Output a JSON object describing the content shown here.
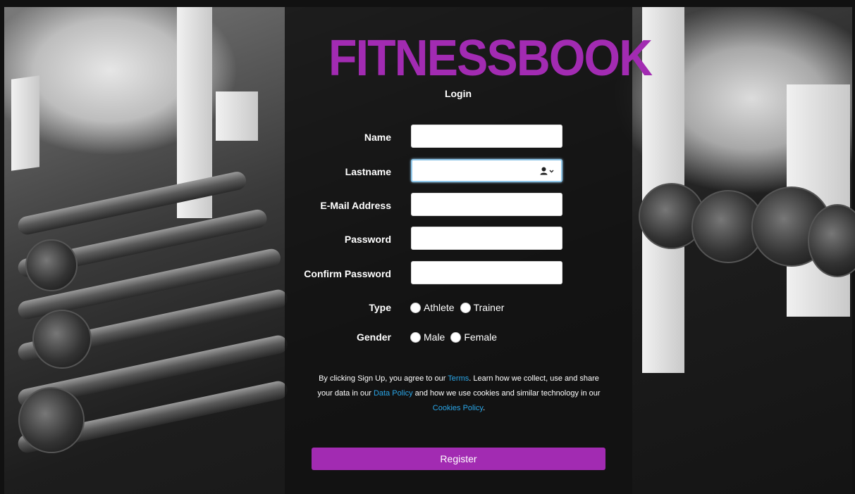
{
  "brand": {
    "name": "FITNESSBOOK",
    "color": "#a22bb2"
  },
  "page": {
    "subtitle": "Login"
  },
  "form": {
    "name_label": "Name",
    "lastname_label": "Lastname",
    "lastname_addon_icon": "person-icon",
    "email_label": "E-Mail Address",
    "password_label": "Password",
    "confirm_password_label": "Confirm Password",
    "type_label": "Type",
    "type_options": [
      "Athlete",
      "Trainer"
    ],
    "gender_label": "Gender",
    "gender_options": [
      "Male",
      "Female"
    ]
  },
  "terms": {
    "part1": "By clicking Sign Up, you agree to our ",
    "terms_link": "Terms",
    "part2": ". Learn how we collect, use and share your data in our ",
    "data_policy_link": "Data Policy",
    "part3": " and how we use cookies and similar technology in our ",
    "cookies_policy_link": "Cookies Policy",
    "part4": ".",
    "link_color": "#2aa6e8"
  },
  "actions": {
    "register_label": "Register",
    "register_color": "#a22bb2"
  }
}
